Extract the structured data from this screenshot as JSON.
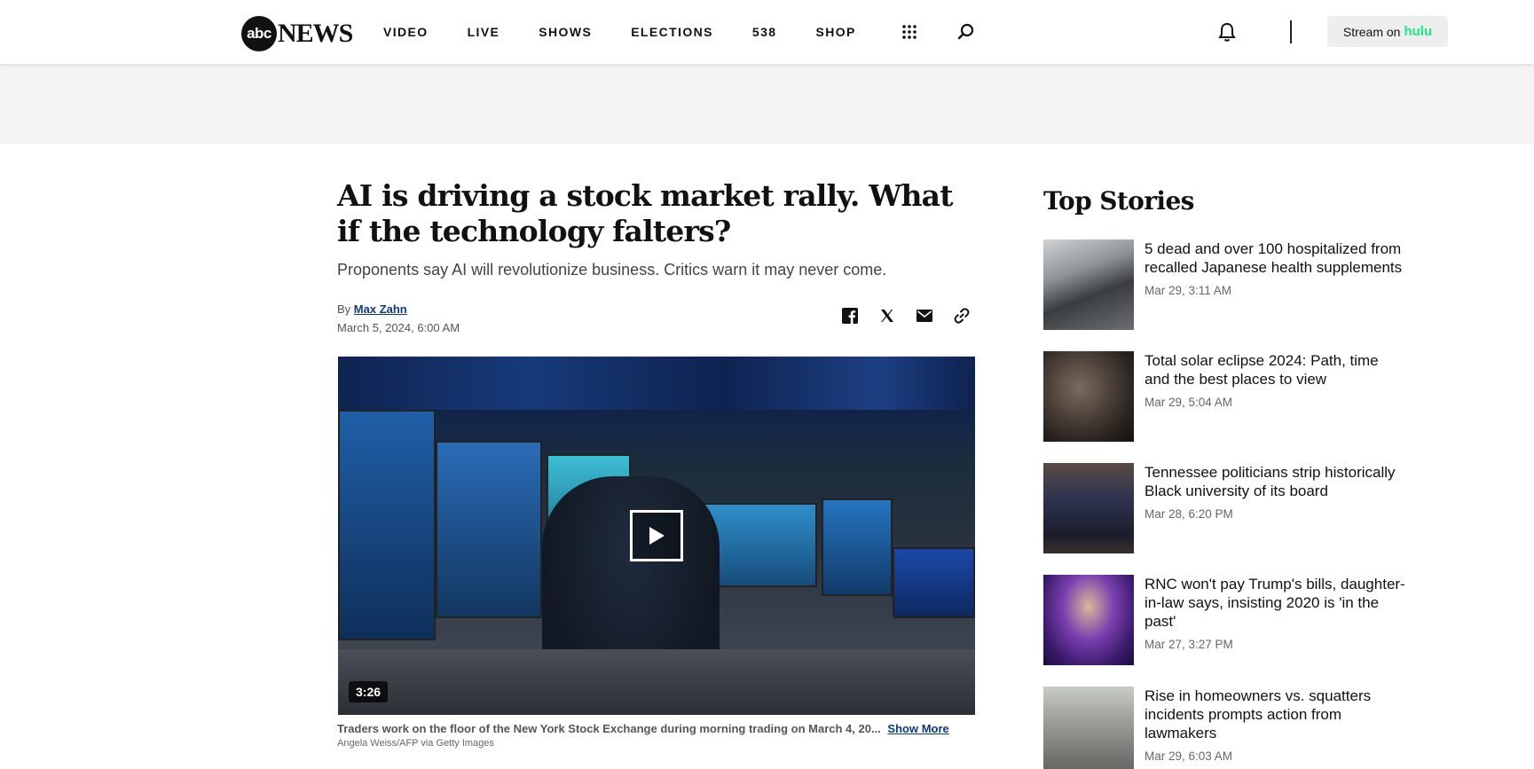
{
  "header": {
    "logo_abc": "abc",
    "logo_news": "NEWS",
    "nav": [
      "VIDEO",
      "LIVE",
      "SHOWS",
      "ELECTIONS",
      "538",
      "SHOP"
    ],
    "stream_label": "Stream on",
    "stream_brand": "hulu",
    "icons": [
      "apps-grid-icon",
      "search-icon",
      "bell-icon"
    ]
  },
  "article": {
    "headline": "AI is driving a stock market rally. What if the technology falters?",
    "subhead": "Proponents say AI will revolutionize business. Critics warn it may never come.",
    "byline_prefix": "By",
    "author": "Max Zahn",
    "date": "March 5, 2024, 6:00 AM",
    "share_icons": [
      "facebook-icon",
      "x-icon",
      "email-icon",
      "link-icon"
    ],
    "video": {
      "duration": "3:26",
      "caption": "Traders work on the floor of the New York Stock Exchange during morning trading on March 4, 20...",
      "show_more": "Show More",
      "credit": "Angela Weiss/AFP via Getty Images"
    }
  },
  "top_stories": {
    "title": "Top Stories",
    "items": [
      {
        "title": "5 dead and over 100 hospitalized from recalled Japanese health supplements",
        "date": "Mar 29, 3:11 AM"
      },
      {
        "title": "Total solar eclipse 2024: Path, time and the best places to view",
        "date": "Mar 29, 5:04 AM"
      },
      {
        "title": "Tennessee politicians strip historically Black university of its board",
        "date": "Mar 28, 6:20 PM"
      },
      {
        "title": "RNC won't pay Trump's bills, daughter-in-law says, insisting 2020 is 'in the past'",
        "date": "Mar 27, 3:27 PM"
      },
      {
        "title": "Rise in homeowners vs. squatters incidents prompts action from lawmakers",
        "date": "Mar 29, 6:03 AM"
      }
    ]
  },
  "colors": {
    "hulu": "#1ce783",
    "link": "#0b3a7e",
    "ad_band": "#f4f4f4"
  }
}
